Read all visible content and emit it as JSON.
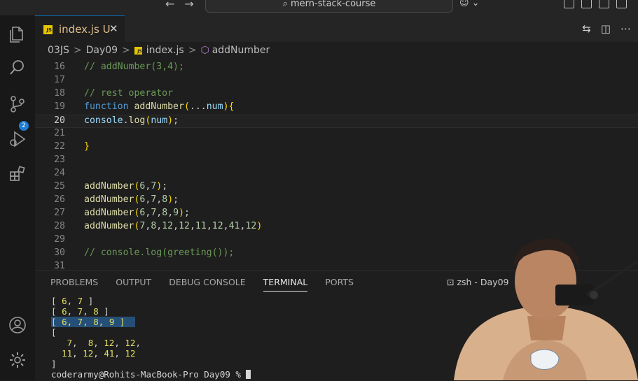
{
  "titlebar": {
    "search": "mern-stack-course",
    "nav_back": "←",
    "nav_forward": "→"
  },
  "activity": {
    "source_control_badge": "2"
  },
  "tab": {
    "file_name": "index.js",
    "status": "U",
    "close": "✕",
    "icon_text": "JS"
  },
  "breadcrumb": {
    "parts": [
      "03JS",
      "Day09",
      "index.js",
      "addNumber"
    ],
    "separator": ">"
  },
  "editor": {
    "current_line": 20,
    "lines": [
      {
        "n": "16",
        "text": "// addNumber(3,4);"
      },
      {
        "n": "17",
        "text": ""
      },
      {
        "n": "18",
        "text": "// rest operator"
      },
      {
        "n": "19",
        "text": "function addNumber(...num){"
      },
      {
        "n": "20",
        "text": "console.log(num);"
      },
      {
        "n": "21",
        "text": ""
      },
      {
        "n": "22",
        "text": "}"
      },
      {
        "n": "23",
        "text": ""
      },
      {
        "n": "24",
        "text": ""
      },
      {
        "n": "25",
        "text": "addNumber(6,7);"
      },
      {
        "n": "26",
        "text": "addNumber(6,7,8);"
      },
      {
        "n": "27",
        "text": "addNumber(6,7,8,9);"
      },
      {
        "n": "28",
        "text": "addNumber(7,8,12,12,11,12,41,12)"
      },
      {
        "n": "29",
        "text": ""
      },
      {
        "n": "30",
        "text": "// console.log(greeting());"
      },
      {
        "n": "31",
        "text": ""
      }
    ]
  },
  "panel": {
    "tabs": [
      "PROBLEMS",
      "OUTPUT",
      "DEBUG CONSOLE",
      "TERMINAL",
      "PORTS"
    ],
    "active_tab": "TERMINAL",
    "terminal_name": "zsh - Day09",
    "terminal_lines": [
      "[ 6, 7 ]",
      "[ 6, 7, 8 ]",
      "[ 6, 7, 8, 9 ]",
      "[",
      "   7,  8, 12, 12,",
      "  11, 12, 41, 12",
      "]"
    ],
    "prompt": "coderarmy@Rohits-MacBook-Pro Day09 % "
  },
  "colors": {
    "accent": "#0e639c",
    "js_badge": "#e5c400",
    "untracked": "#e2c08d",
    "selection": "#264f78"
  }
}
